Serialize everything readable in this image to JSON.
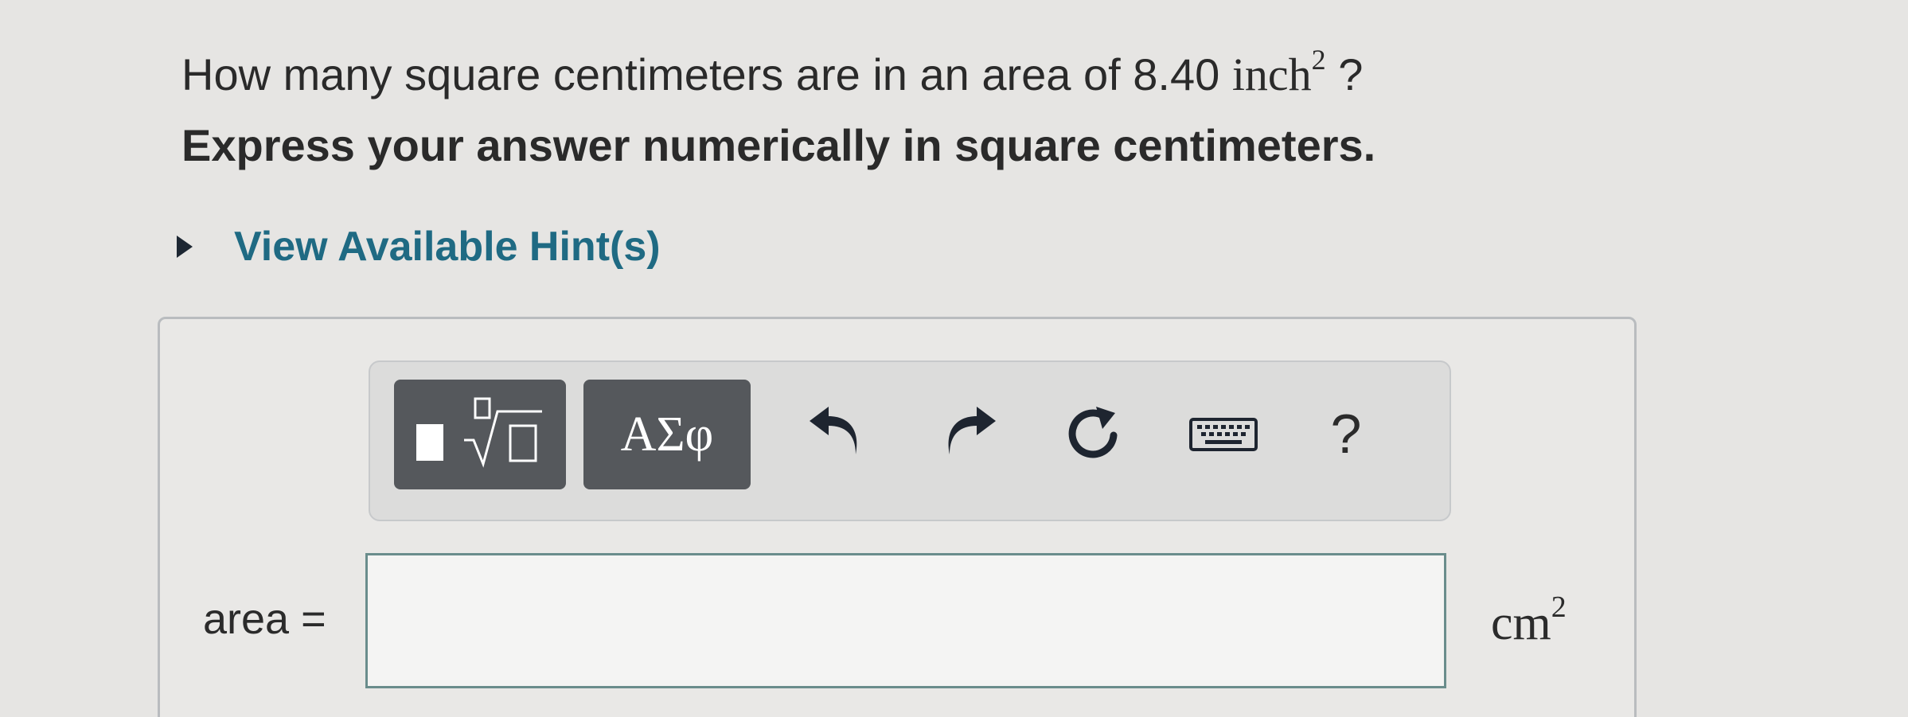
{
  "question": {
    "prefix": "How many square centimeters are in an area of 8.40",
    "unit_base": "inch",
    "unit_exp": "2",
    "suffix": "?"
  },
  "instruction": "Express your answer numerically in square centimeters.",
  "hint": {
    "label": "View Available Hint(s)"
  },
  "toolbar": {
    "templates_icon": "templates-icon",
    "symbols_label": "ΑΣφ",
    "undo_icon": "undo-icon",
    "redo_icon": "redo-icon",
    "reset_icon": "reset-icon",
    "keyboard_icon": "keyboard-icon",
    "help_label": "?"
  },
  "answer": {
    "label": "area =",
    "value": "",
    "unit_base": "cm",
    "unit_exp": "2"
  }
}
